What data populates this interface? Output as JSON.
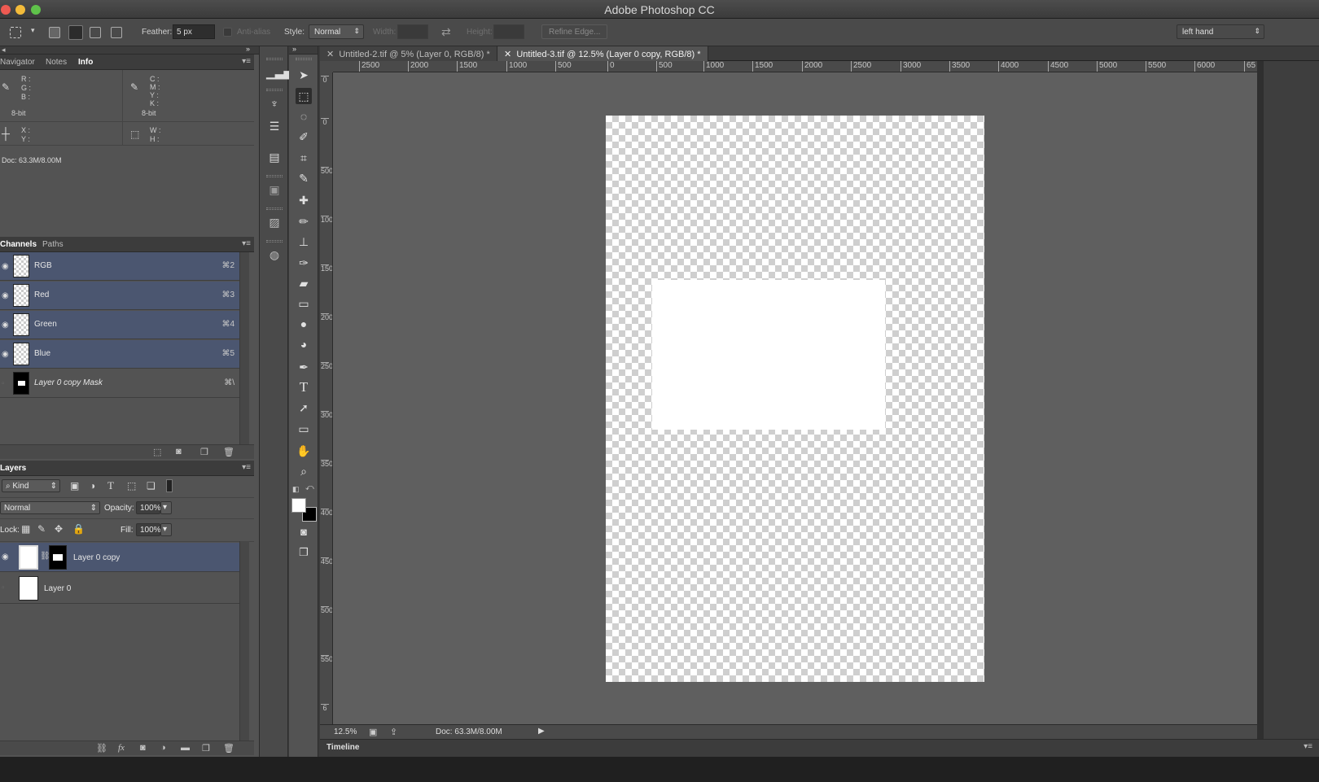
{
  "app": {
    "title": "Adobe Photoshop CC"
  },
  "options": {
    "feather_label": "Feather:",
    "feather_value": "5 px",
    "antialias_label": "Anti-alias",
    "style_label": "Style:",
    "style_value": "Normal",
    "width_label": "Width:",
    "height_label": "Height:",
    "refine_label": "Refine Edge...",
    "workspace_value": "left hand"
  },
  "info_panel": {
    "tabs": [
      "Navigator",
      "Notes",
      "Info"
    ],
    "rgb_labels": [
      "R :",
      "G :",
      "B :"
    ],
    "cmyk_labels": [
      "C :",
      "M :",
      "Y :",
      "K :"
    ],
    "bitdepth_left": "8-bit",
    "bitdepth_right": "8-bit",
    "xy_labels": [
      "X :",
      "Y :"
    ],
    "wh_labels": [
      "W :",
      "H :"
    ],
    "doc_size": "Doc: 63.3M/8.00M"
  },
  "channels_panel": {
    "tabs": [
      "Channels",
      "Paths"
    ],
    "rows": [
      {
        "name": "RGB",
        "shortcut": "⌘2"
      },
      {
        "name": "Red",
        "shortcut": "⌘3"
      },
      {
        "name": "Green",
        "shortcut": "⌘4"
      },
      {
        "name": "Blue",
        "shortcut": "⌘5"
      },
      {
        "name": "Layer 0 copy Mask",
        "shortcut": "⌘\\"
      }
    ]
  },
  "layers_panel": {
    "tab": "Layers",
    "filter_value": "Kind",
    "blend_mode": "Normal",
    "opacity_label": "Opacity:",
    "opacity_value": "100%",
    "lock_label": "Lock:",
    "fill_label": "Fill:",
    "fill_value": "100%",
    "layers": [
      {
        "name": "Layer 0 copy"
      },
      {
        "name": "Layer 0"
      }
    ]
  },
  "documents": {
    "tabs": [
      {
        "label": "Untitled-2.tif @ 5% (Layer 0, RGB/8) *"
      },
      {
        "label": "Untitled-3.tif @ 12.5% (Layer 0 copy, RGB/8) *"
      }
    ]
  },
  "ruler": {
    "h_ticks": [
      "2500",
      "2000",
      "1500",
      "1000",
      "500",
      "0",
      "500",
      "1000",
      "1500",
      "2000",
      "2500",
      "3000",
      "3500",
      "4000",
      "4500",
      "5000",
      "5500",
      "6000",
      "65"
    ],
    "v_ticks": [
      "0",
      "0",
      "500",
      "1000",
      "1500",
      "2000",
      "2500",
      "3000",
      "3500",
      "4000",
      "4500",
      "5000",
      "5500",
      "6"
    ]
  },
  "status": {
    "zoom": "12.5%",
    "doc": "Doc: 63.3M/8.00M"
  },
  "timeline": {
    "label": "Timeline"
  },
  "colors": {
    "selection_row": "#4b5670",
    "canvas_bg": "#5f5f5f",
    "panel_bg": "#535353"
  }
}
